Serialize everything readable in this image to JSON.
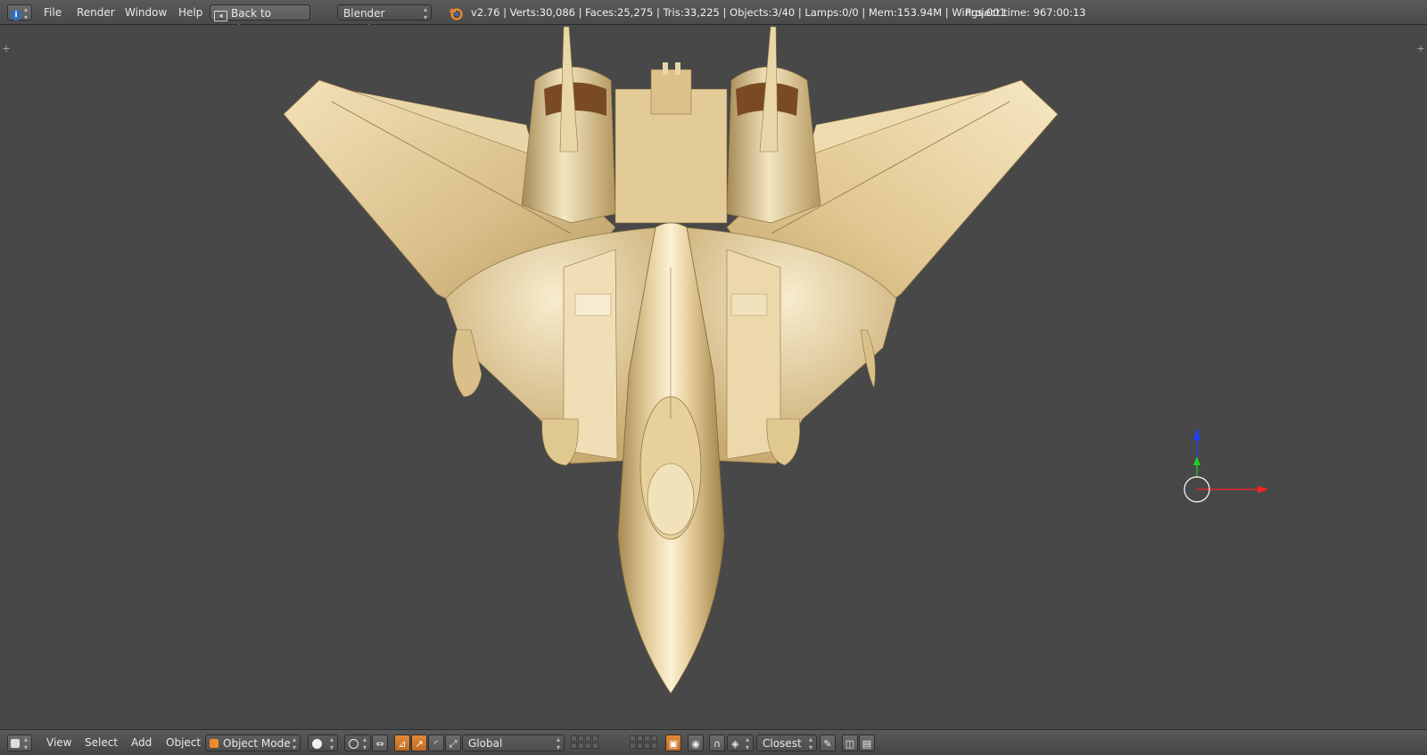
{
  "topbar": {
    "info_icon": "info-icon",
    "menus": [
      "File",
      "Render",
      "Window",
      "Help"
    ],
    "back_button": "Back to Previous",
    "render_engine": "Blender Render",
    "stats": "v2.76 | Verts:30,086 | Faces:25,275 | Tris:33,225 | Objects:3/40 | Lamps:0/0 | Mem:153.94M | Wings.001",
    "project_time": "Project time: 967:00:13"
  },
  "bottombar": {
    "menus": [
      "View",
      "Select",
      "Add",
      "Object"
    ],
    "mode": "Object Mode",
    "orientation": "Global",
    "snap_target": "Closest"
  },
  "gizmo": {
    "x_color": "#ff2020",
    "y_color": "#20d020",
    "z_color": "#2040ff"
  },
  "model": {
    "base_color": "#e8d2a0"
  }
}
